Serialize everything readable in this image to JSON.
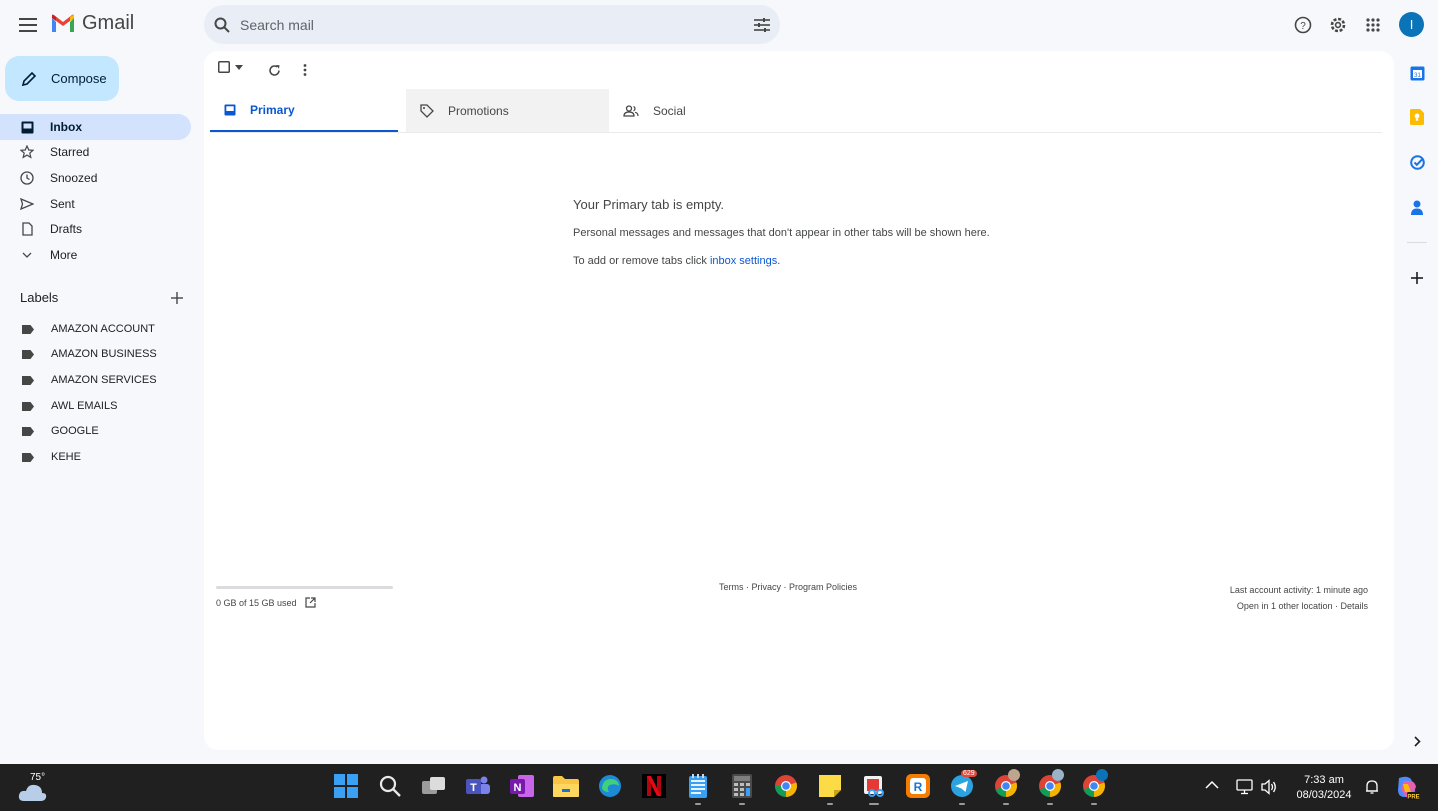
{
  "header": {
    "app_name": "Gmail",
    "search": {
      "placeholder": "Search mail"
    },
    "avatar_initial": "I"
  },
  "sidebar": {
    "compose_label": "Compose",
    "items": [
      {
        "label": "Inbox",
        "icon": "inbox-icon",
        "active": true
      },
      {
        "label": "Starred",
        "icon": "star-icon"
      },
      {
        "label": "Snoozed",
        "icon": "clock-icon"
      },
      {
        "label": "Sent",
        "icon": "send-icon"
      },
      {
        "label": "Drafts",
        "icon": "draft-icon"
      },
      {
        "label": "More",
        "icon": "chevron-down-icon"
      }
    ],
    "labels_title": "Labels",
    "labels": [
      {
        "label": "AMAZON ACCOUNT"
      },
      {
        "label": "AMAZON BUSINESS"
      },
      {
        "label": "AMAZON SERVICES"
      },
      {
        "label": "AWL EMAILS"
      },
      {
        "label": "GOOGLE"
      },
      {
        "label": "KEHE"
      }
    ]
  },
  "tabs": [
    {
      "label": "Primary",
      "icon": "inbox-icon",
      "selected": true
    },
    {
      "label": "Promotions",
      "icon": "tag-icon"
    },
    {
      "label": "Social",
      "icon": "people-icon"
    }
  ],
  "empty_state": {
    "title": "Your Primary tab is empty.",
    "description": "Personal messages and messages that don't appear in other tabs will be shown here.",
    "tip_prefix": "To add or remove tabs click ",
    "tip_link": "inbox settings",
    "tip_suffix": "."
  },
  "footer": {
    "storage_text": "0 GB of 15 GB used",
    "storage_fraction": 0,
    "links": "Terms · Privacy · Program Policies",
    "last_activity": "Last account activity: 1 minute ago",
    "other_location": "Open in 1 other location · Details"
  },
  "taskbar": {
    "weather_temp": "75°",
    "time": "7:33 am",
    "date": "08/03/2024",
    "telegram_badge": "629"
  },
  "colors": {
    "accent": "#0b57d0",
    "compose_bg": "#c2e7ff",
    "active_nav_bg": "#d3e3fd",
    "page_bg": "#f6f8fc"
  }
}
